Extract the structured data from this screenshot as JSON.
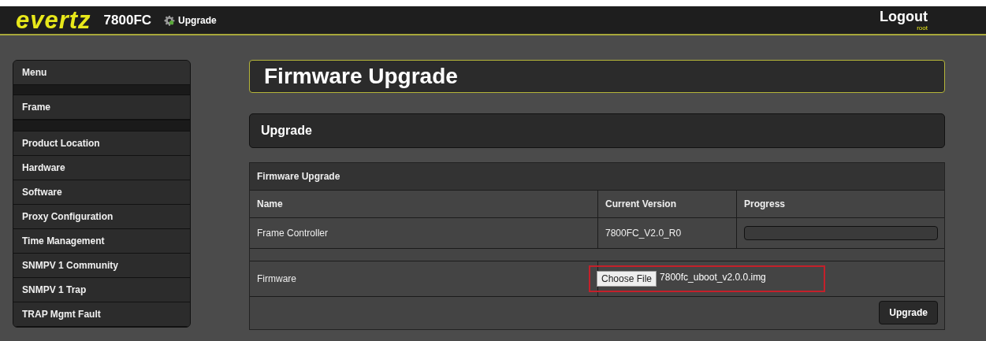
{
  "header": {
    "logo": "evertz",
    "model": "7800FC",
    "page": "Upgrade",
    "logout": "Logout",
    "user": "root"
  },
  "sidebar": {
    "title": "Menu",
    "items": [
      {
        "label": "Frame",
        "group_end": true
      },
      {
        "label": "Product Location",
        "group_end": false
      },
      {
        "label": "Hardware",
        "group_end": false
      },
      {
        "label": "Software",
        "group_end": false
      },
      {
        "label": "Proxy Configuration",
        "group_end": false
      },
      {
        "label": "Time Management",
        "group_end": false
      },
      {
        "label": "SNMPV 1 Community",
        "group_end": false
      },
      {
        "label": "SNMPV 1 Trap",
        "group_end": false
      },
      {
        "label": "TRAP Mgmt Fault",
        "group_end": false
      }
    ]
  },
  "page_title": "Firmware Upgrade",
  "section_title": "Upgrade",
  "table": {
    "title": "Firmware Upgrade",
    "columns": [
      "Name",
      "Current Version",
      "Progress"
    ],
    "controller_row": {
      "name": "Frame Controller",
      "version": "7800FC_V2.0_R0",
      "level": 0
    },
    "firmware_row": {
      "name": "Firmware",
      "choose_button": "Choose File",
      "file_name": "7800fc_uboot_v2.0.0.img",
      "highlighted": true
    },
    "upgrade_button": "Upgrade"
  }
}
